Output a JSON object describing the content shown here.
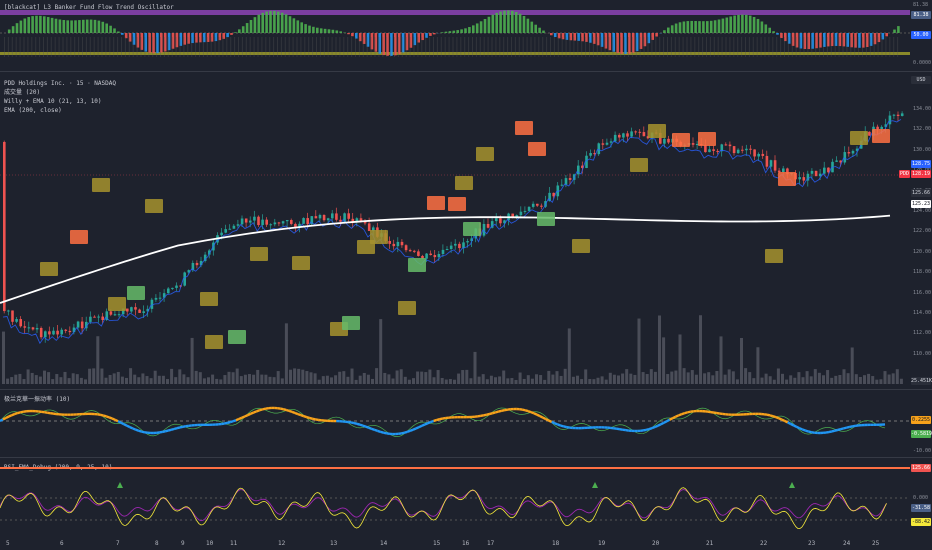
{
  "osc_title": "[blackcat] L3 Banker Fund Flow Trend Oscillator",
  "main_legend": {
    "symbol": "PDD Holdings Inc. · 15 · NASDAQ",
    "volume": "成交量 (20)",
    "willy": "Willy + EMA 10 (21, 13, 10)",
    "ema": "EMA (200, close)"
  },
  "sub1_title": "极兰克華一振动率 (10)",
  "sub2_title": "RSI_EMA_Debug (200, 9, 25, 10)",
  "osc_axis": {
    "top": "81.38",
    "mid": "50.00",
    "bottom": "0.0000"
  },
  "osc_tags": {
    "a": "81.38",
    "b": "50.00"
  },
  "price_ticks": [
    "134.00",
    "132.00",
    "130.00",
    "128.00",
    "126.00",
    "124.00",
    "122.00",
    "120.00",
    "118.00",
    "116.00",
    "114.00",
    "112.00",
    "110.00"
  ],
  "price_tags": {
    "usd": "USD",
    "price1": "128.75",
    "pdd": "PDD",
    "price2": "128.19",
    "price3": "125.66",
    "ema": "125.23",
    "vol": "25.451K"
  },
  "sub1_ticks": {
    "top": "0.2255",
    "low": "-0.5819",
    "bottom": "-10.00"
  },
  "sub2_ticks": {
    "top": "125.66",
    "t0": "0.000",
    "t1": "-31.58",
    "t2": "-88.42"
  },
  "x_labels": [
    "5",
    "6",
    "7",
    "8",
    "9",
    "10",
    "11",
    "12",
    "13",
    "14",
    "15",
    "16",
    "17",
    "18",
    "19",
    "20",
    "21",
    "22",
    "23",
    "24",
    "25"
  ],
  "colors": {
    "bg": "#1e222d",
    "up": "#26a69a",
    "down": "#ef5350",
    "ema": "#ffffff",
    "orange": "#f7a21b",
    "purple": "#9c27b0"
  }
}
